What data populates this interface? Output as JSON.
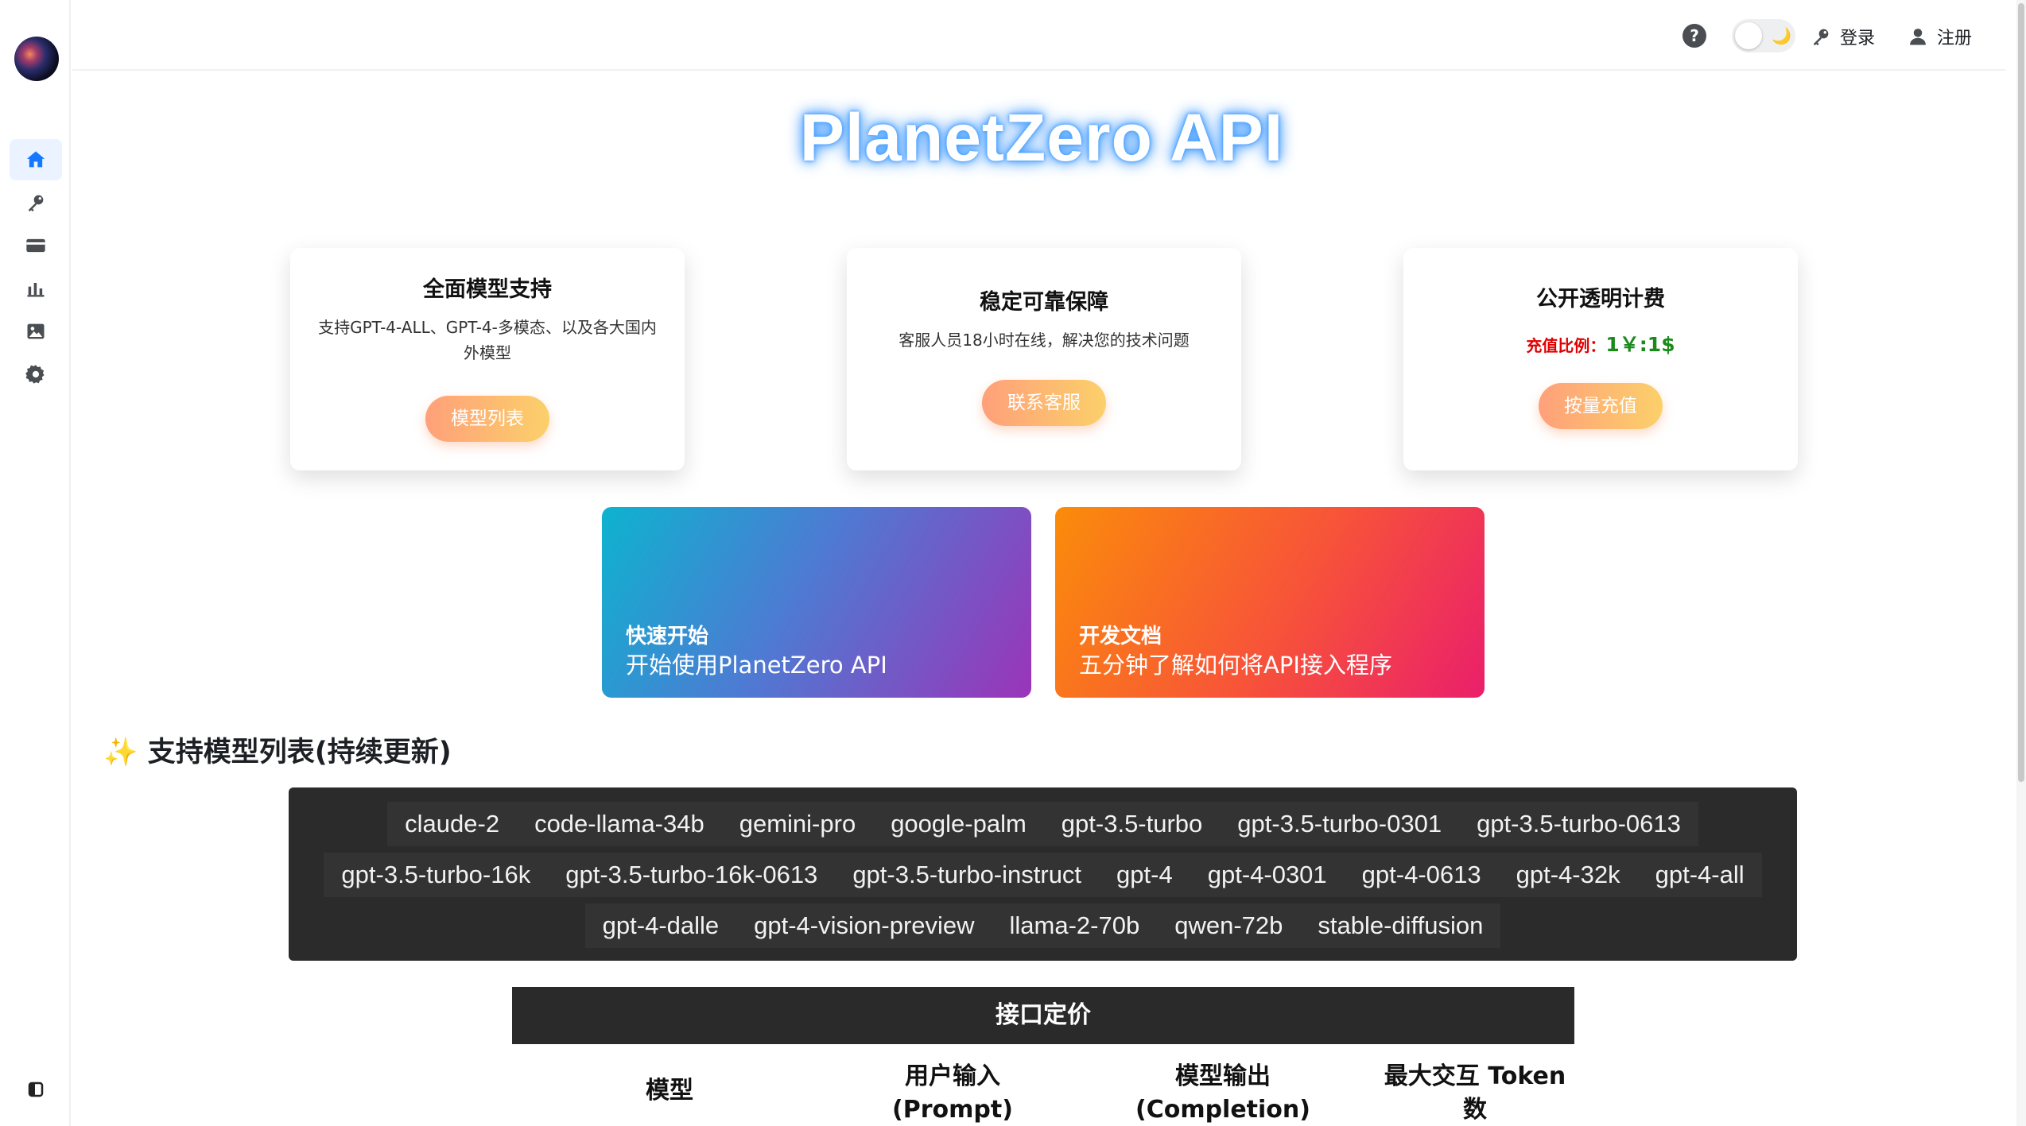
{
  "sidebar": {
    "items": [
      {
        "name": "home",
        "icon": "home-icon"
      },
      {
        "name": "token",
        "icon": "key-icon"
      },
      {
        "name": "topup",
        "icon": "credit-card-icon"
      },
      {
        "name": "usage",
        "icon": "bar-chart-icon"
      },
      {
        "name": "drawing",
        "icon": "image-icon"
      },
      {
        "name": "settings",
        "icon": "gear-icon"
      }
    ],
    "collapse_icon": "sidebar-collapse-icon"
  },
  "header": {
    "help_glyph": "?",
    "moon_glyph": "🌙",
    "login_label": "登录",
    "register_label": "注册"
  },
  "hero": {
    "title": "PlanetZero API"
  },
  "cards": [
    {
      "title": "全面模型支持",
      "desc": "支持GPT-4-ALL、GPT-4-多模态、以及各大国内外模型",
      "button": "模型列表"
    },
    {
      "title": "稳定可靠保障",
      "desc": "客服人员18小时在线，解决您的技术问题",
      "button": "联系客服"
    },
    {
      "title": "公开透明计费",
      "ratio_label": "充值比例：",
      "ratio_value": "1￥:1$",
      "button": "按量充值"
    }
  ],
  "tiles": [
    {
      "title": "快速开始",
      "subtitle": "开始使用PlanetZero API"
    },
    {
      "title": "开发文档",
      "subtitle": "五分钟了解如何将API接入程序"
    }
  ],
  "models_section": {
    "title": "✨ 支持模型列表(持续更新)",
    "models": [
      "claude-2",
      "code-llama-34b",
      "gemini-pro",
      "google-palm",
      "gpt-3.5-turbo",
      "gpt-3.5-turbo-0301",
      "gpt-3.5-turbo-0613",
      "gpt-3.5-turbo-16k",
      "gpt-3.5-turbo-16k-0613",
      "gpt-3.5-turbo-instruct",
      "gpt-4",
      "gpt-4-0301",
      "gpt-4-0613",
      "gpt-4-32k",
      "gpt-4-all",
      "gpt-4-dalle",
      "gpt-4-vision-preview",
      "llama-2-70b",
      "qwen-72b",
      "stable-diffusion"
    ]
  },
  "pricing": {
    "title": "接口定价",
    "columns": [
      {
        "line1": "模型",
        "line2": ""
      },
      {
        "line1": "用户输入",
        "line2": "(Prompt)"
      },
      {
        "line1": "模型输出",
        "line2": "(Completion)"
      },
      {
        "line1": "最大交互 Token",
        "line2": "数"
      }
    ]
  },
  "colors": {
    "accent": "#1f7bff",
    "button_gradient_start": "#ffa07a",
    "button_gradient_end": "#fbd06a",
    "ratio_label": "#e00000",
    "ratio_value": "#1a8a1a",
    "dark_panel": "#2b2b2b"
  }
}
